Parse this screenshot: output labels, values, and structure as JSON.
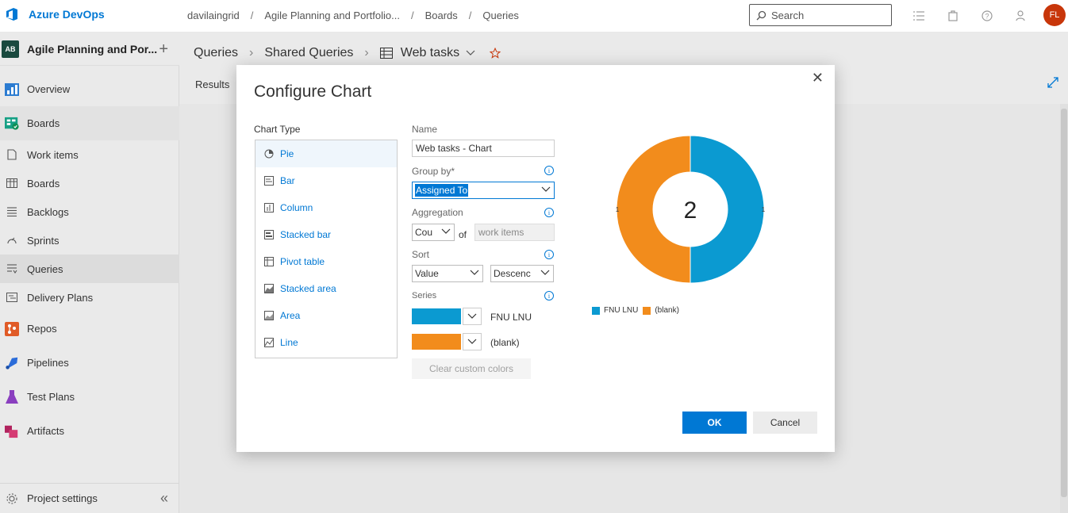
{
  "topbar": {
    "brand": "Azure DevOps",
    "breadcrumbs": [
      "davilaingrid",
      "Agile Planning and Portfolio...",
      "Boards",
      "Queries"
    ],
    "search_placeholder": "Search",
    "avatar_initials": "FL"
  },
  "sidebar": {
    "project_badge": "AB",
    "project_name": "Agile Planning and Por...",
    "items": [
      {
        "label": "Overview",
        "icon": "overview-icon"
      },
      {
        "label": "Boards",
        "icon": "boards-hub-icon"
      },
      {
        "label": "Work items",
        "icon": "work-items-icon"
      },
      {
        "label": "Boards",
        "icon": "boards-icon"
      },
      {
        "label": "Backlogs",
        "icon": "backlogs-icon"
      },
      {
        "label": "Sprints",
        "icon": "sprints-icon"
      },
      {
        "label": "Queries",
        "icon": "queries-icon"
      },
      {
        "label": "Delivery Plans",
        "icon": "delivery-plans-icon"
      },
      {
        "label": "Repos",
        "icon": "repos-icon"
      },
      {
        "label": "Pipelines",
        "icon": "pipelines-icon"
      },
      {
        "label": "Test Plans",
        "icon": "test-plans-icon"
      },
      {
        "label": "Artifacts",
        "icon": "artifacts-icon"
      }
    ],
    "settings_label": "Project settings"
  },
  "main": {
    "breadcrumb": [
      "Queries",
      "Shared Queries",
      "Web tasks"
    ],
    "results_tab": "Results"
  },
  "dialog": {
    "title": "Configure Chart",
    "chart_type_label": "Chart Type",
    "chart_types": [
      {
        "label": "Pie",
        "icon": "pie-icon"
      },
      {
        "label": "Bar",
        "icon": "bar-icon"
      },
      {
        "label": "Column",
        "icon": "column-icon"
      },
      {
        "label": "Stacked bar",
        "icon": "stacked-bar-icon"
      },
      {
        "label": "Pivot table",
        "icon": "pivot-table-icon"
      },
      {
        "label": "Stacked area",
        "icon": "stacked-area-icon"
      },
      {
        "label": "Area",
        "icon": "area-icon"
      },
      {
        "label": "Line",
        "icon": "line-icon"
      }
    ],
    "selected_chart_type": "Pie",
    "name_label": "Name",
    "name_value": "Web tasks - Chart",
    "group_by_label": "Group by*",
    "group_by_value": "Assigned To",
    "aggregation_label": "Aggregation",
    "aggregation_value": "Cou",
    "of_label": "of",
    "aggregation_field": "work items",
    "sort_label": "Sort",
    "sort_by_value": "Value",
    "sort_order_value": "Descenc",
    "series_label": "Series",
    "series": [
      {
        "name": "FNU LNU",
        "color": "#0b9ad1"
      },
      {
        "name": "(blank)",
        "color": "#f28c1c"
      }
    ],
    "clear_colors_label": "Clear custom colors",
    "ok_label": "OK",
    "cancel_label": "Cancel"
  },
  "chart_data": {
    "type": "pie",
    "total_label": "2",
    "categories": [
      "FNU LNU",
      "(blank)"
    ],
    "values": [
      1,
      1
    ],
    "colors": [
      "#0b9ad1",
      "#f28c1c"
    ],
    "legend_position": "bottom-left"
  }
}
